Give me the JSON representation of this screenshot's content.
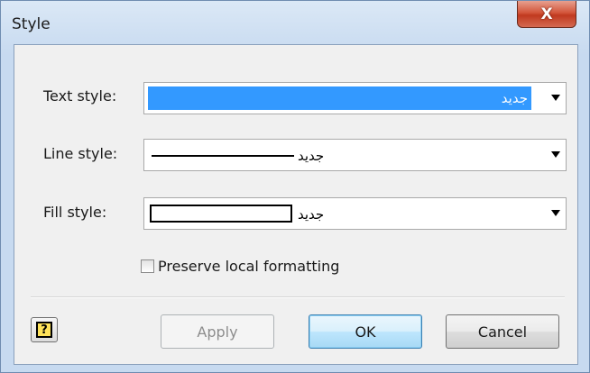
{
  "window": {
    "title": "Style",
    "close_glyph": "X"
  },
  "fields": {
    "text_style": {
      "label": "Text style:",
      "value": "جديد"
    },
    "line_style": {
      "label": "Line style:",
      "value": "جديد"
    },
    "fill_style": {
      "label": "Fill style:",
      "value": "جديد"
    }
  },
  "options": {
    "preserve_local_formatting": {
      "label": "Preserve local formatting",
      "checked": false
    }
  },
  "buttons": {
    "help_glyph": "?",
    "apply": "Apply",
    "ok": "OK",
    "cancel": "Cancel"
  },
  "colors": {
    "selection": "#3399ff",
    "close_button": "#c0391f",
    "help_icon": "#ffe35a"
  },
  "icons": {
    "close": "close-icon",
    "help": "help-icon",
    "dropdown": "chevron-down-icon"
  }
}
